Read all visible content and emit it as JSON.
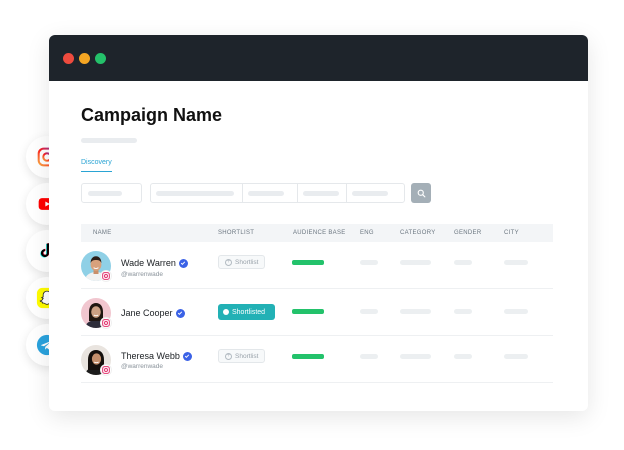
{
  "window": {
    "traffic_lights": [
      "#ee4b3e",
      "#f5a623",
      "#24c16a"
    ]
  },
  "page": {
    "title": "Campaign Name",
    "tab_label": "Discovery"
  },
  "social": [
    "instagram-icon",
    "youtube-icon",
    "tiktok-icon",
    "snapchat-icon",
    "telegram-icon"
  ],
  "table": {
    "headers": [
      "NAME",
      "SHORTLIST",
      "AUDIENCE BASE",
      "ENG",
      "CATEGORY",
      "GENDER",
      "CITY"
    ],
    "rows": [
      {
        "name": "Wade Warren",
        "handle": "@warrenwade",
        "shortlist": "Shortlist",
        "shortlisted": false,
        "audience_fraction": 0.62
      },
      {
        "name": "Jane Cooper",
        "handle": "",
        "shortlist": "Shortlisted",
        "shortlisted": true,
        "audience_fraction": 0.62
      },
      {
        "name": "Theresa Webb",
        "handle": "@warrenwade",
        "shortlist": "Shortlist",
        "shortlisted": false,
        "audience_fraction": 0.62
      }
    ]
  },
  "colors": {
    "accent": "#2aa4d4",
    "shortlisted": "#22b1b5",
    "audience_bar": "#23c26b",
    "verified": "#3b62e6",
    "titlebar": "#1e242b"
  }
}
